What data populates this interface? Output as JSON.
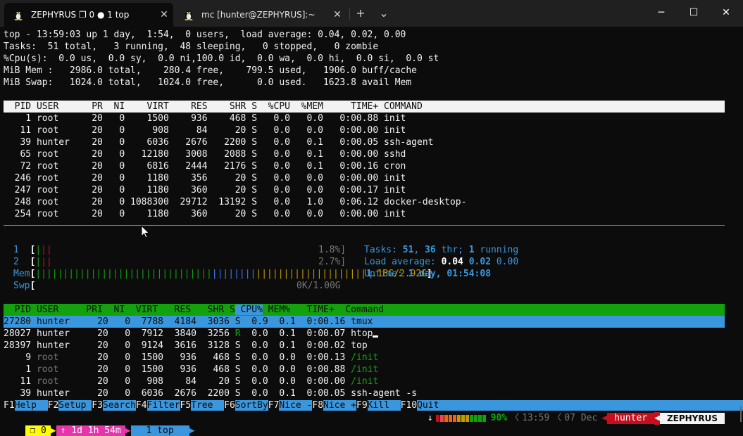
{
  "titlebar": {
    "tabs": [
      {
        "title": "ZEPHYRUS ❐ 0 ● 1 top",
        "close": "✕",
        "icon": "tux-icon"
      },
      {
        "title": "mc [hunter@ZEPHYRUS]:~",
        "close": "✕",
        "icon": "tux-icon"
      }
    ],
    "new_tab": "+",
    "dropdown": "⌄",
    "minimize": "─",
    "maximize": "☐",
    "close": "✕"
  },
  "top": {
    "line1": "top - 13:59:03 up 1 day,  1:54,  0 users,  load average: 0.04, 0.02, 0.00",
    "line2": "Tasks:  51 total,   3 running,  48 sleeping,   0 stopped,   0 zombie",
    "line3": "%Cpu(s):  0.0 us,  0.0 sy,  0.0 ni,100.0 id,  0.0 wa,  0.0 hi,  0.0 si,  0.0 st",
    "line4": "MiB Mem :   2986.0 total,    280.4 free,    799.5 used,   1906.0 buff/cache",
    "line5": "MiB Swap:   1024.0 total,   1024.0 free,      0.0 used.   1623.8 avail Mem",
    "header": "  PID USER      PR  NI    VIRT    RES    SHR S  %CPU  %MEM     TIME+ COMMAND                                                        ",
    "rows": [
      "    1 root      20   0    1500    936    468 S   0.0   0.0   0:00.88 init",
      "   11 root      20   0     908     84     20 S   0.0   0.0   0:00.00 init",
      "   39 hunter    20   0    6036   2676   2200 S   0.0   0.1   0:00.05 ssh-agent",
      "   65 root      20   0   12180   3008   2088 S   0.0   0.1   0:00.00 sshd",
      "   72 root      20   0    6816   2444   2176 S   0.0   0.1   0:00.16 cron",
      "  246 root      20   0    1180    356     20 S   0.0   0.0   0:00.00 init",
      "  247 root      20   0    1180    360     20 S   0.0   0.0   0:00.17 init",
      "  248 root      20   0 1088300  29712  13192 S   0.0   1.0   0:06.12 docker-desktop-",
      "  254 root      20   0    1180    360     20 S   0.0   0.0   0:00.00 init"
    ]
  },
  "htop": {
    "cpu1_label": "1",
    "cpu1_value": "1.8%]",
    "cpu2_label": "2",
    "cpu2_value": "2.7%]",
    "mem_label": "Mem",
    "mem_value": "1.18G/2.92G",
    "swp_label": "Swp",
    "swp_value": "0K/1.00G",
    "tasks_label": "Tasks:",
    "tasks_count": "51",
    "tasks_thr": "36",
    "tasks_thr_label": "thr;",
    "tasks_running": "1",
    "tasks_running_label": "running",
    "load_label": "Load average:",
    "load1": "0.04",
    "load5": "0.02",
    "load15": "0.00",
    "uptime_label": "Uptime:",
    "uptime_value": "1 day, 01:54:08",
    "header": {
      "pid": "  PID",
      "user": " USER     ",
      "pri": "PRI",
      "ni": "  NI",
      "virt": "  VIRT",
      "res": "   RES",
      "shr": "   SHR",
      "s": " S",
      "cpu": " CPU%",
      "mem": " MEM%",
      "time": "   TIME+",
      "cmd": "  Command                                                        "
    },
    "rows": [
      {
        "pid": "27280",
        "user": "hunter",
        "pri": "20",
        "ni": "0",
        "virt": "7788",
        "res": "4184",
        "shr": "3036",
        "s": "S",
        "cpu": "0.9",
        "mem": "0.1",
        "time": "0:00.16",
        "cmd": "tmux"
      },
      {
        "pid": "28027",
        "user": "hunter",
        "pri": "20",
        "ni": "0",
        "virt": "7912",
        "res": "3840",
        "shr": "3256",
        "s": "R",
        "cpu": "0.0",
        "mem": "0.1",
        "time": "0:00.07",
        "cmd": "htop"
      },
      {
        "pid": "28397",
        "user": "hunter",
        "pri": "20",
        "ni": "0",
        "virt": "9124",
        "res": "3616",
        "shr": "3128",
        "s": "S",
        "cpu": "0.0",
        "mem": "0.1",
        "time": "0:00.02",
        "cmd": "top"
      },
      {
        "pid": "9",
        "user": "root",
        "pri": "20",
        "ni": "0",
        "virt": "1500",
        "res": "936",
        "shr": "468",
        "s": "S",
        "cpu": "0.0",
        "mem": "0.0",
        "time": "0:00.13",
        "cmd": "/init"
      },
      {
        "pid": "1",
        "user": "root",
        "pri": "20",
        "ni": "0",
        "virt": "1500",
        "res": "936",
        "shr": "468",
        "s": "S",
        "cpu": "0.0",
        "mem": "0.0",
        "time": "0:00.88",
        "cmd": "/init"
      },
      {
        "pid": "11",
        "user": "root",
        "pri": "20",
        "ni": "0",
        "virt": "908",
        "res": "84",
        "shr": "20",
        "s": "S",
        "cpu": "0.0",
        "mem": "0.0",
        "time": "0:00.00",
        "cmd": "/init"
      },
      {
        "pid": "39",
        "user": "hunter",
        "pri": "20",
        "ni": "0",
        "virt": "6036",
        "res": "2676",
        "shr": "2200",
        "s": "S",
        "cpu": "0.0",
        "mem": "0.1",
        "time": "0:00.05",
        "cmd": "ssh-agent -s"
      }
    ],
    "fkeys": [
      {
        "key": "F1",
        "label": "Help  "
      },
      {
        "key": "F2",
        "label": "Setup "
      },
      {
        "key": "F3",
        "label": "Search"
      },
      {
        "key": "F4",
        "label": "Filter"
      },
      {
        "key": "F5",
        "label": "Tree  "
      },
      {
        "key": "F6",
        "label": "SortBy"
      },
      {
        "key": "F7",
        "label": "Nice -"
      },
      {
        "key": "F8",
        "label": "Nice +"
      },
      {
        "key": "F9",
        "label": "Kill  "
      },
      {
        "key": "F10",
        "label": "Quit                                                        "
      }
    ]
  },
  "tmux": {
    "session": "❐ 0",
    "uptime": "↑ 1d 1h 54m",
    "window": "1 top",
    "battery_arrow": "↓",
    "battery_pct": "90%",
    "time": "13:59",
    "date": "07 Dec",
    "user": "hunter",
    "host": "ZEPHYRUS"
  },
  "colors": {
    "green": "#13a10e",
    "cyan": "#3a96dd",
    "pink": "#e535ab",
    "yellow": "#ffff00",
    "red": "#c50f1f"
  }
}
